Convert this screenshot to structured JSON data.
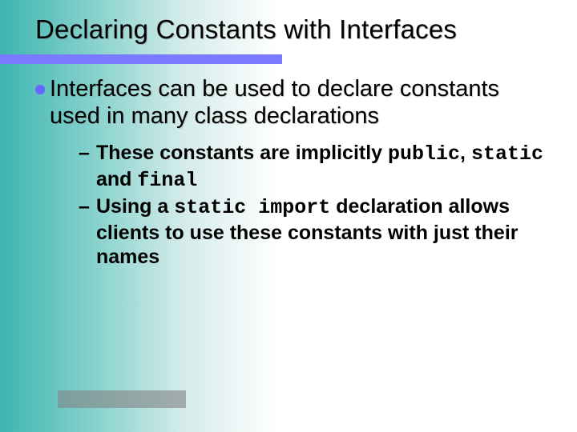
{
  "title": "Declaring Constants with Interfaces",
  "main_point": {
    "text_part1": "Interfaces can be used to declare constants used in many class declarations"
  },
  "sub_points": [
    {
      "prefix": "These constants are implicitly ",
      "code1": "public",
      "mid1": ", ",
      "code2": "static",
      "mid2": " and ",
      "code3": "final",
      "suffix": ""
    },
    {
      "prefix": "Using a ",
      "code1": "static import",
      "mid1": " declaration allows clients to use these constants with just their names",
      "code2": "",
      "mid2": "",
      "code3": "",
      "suffix": ""
    }
  ]
}
